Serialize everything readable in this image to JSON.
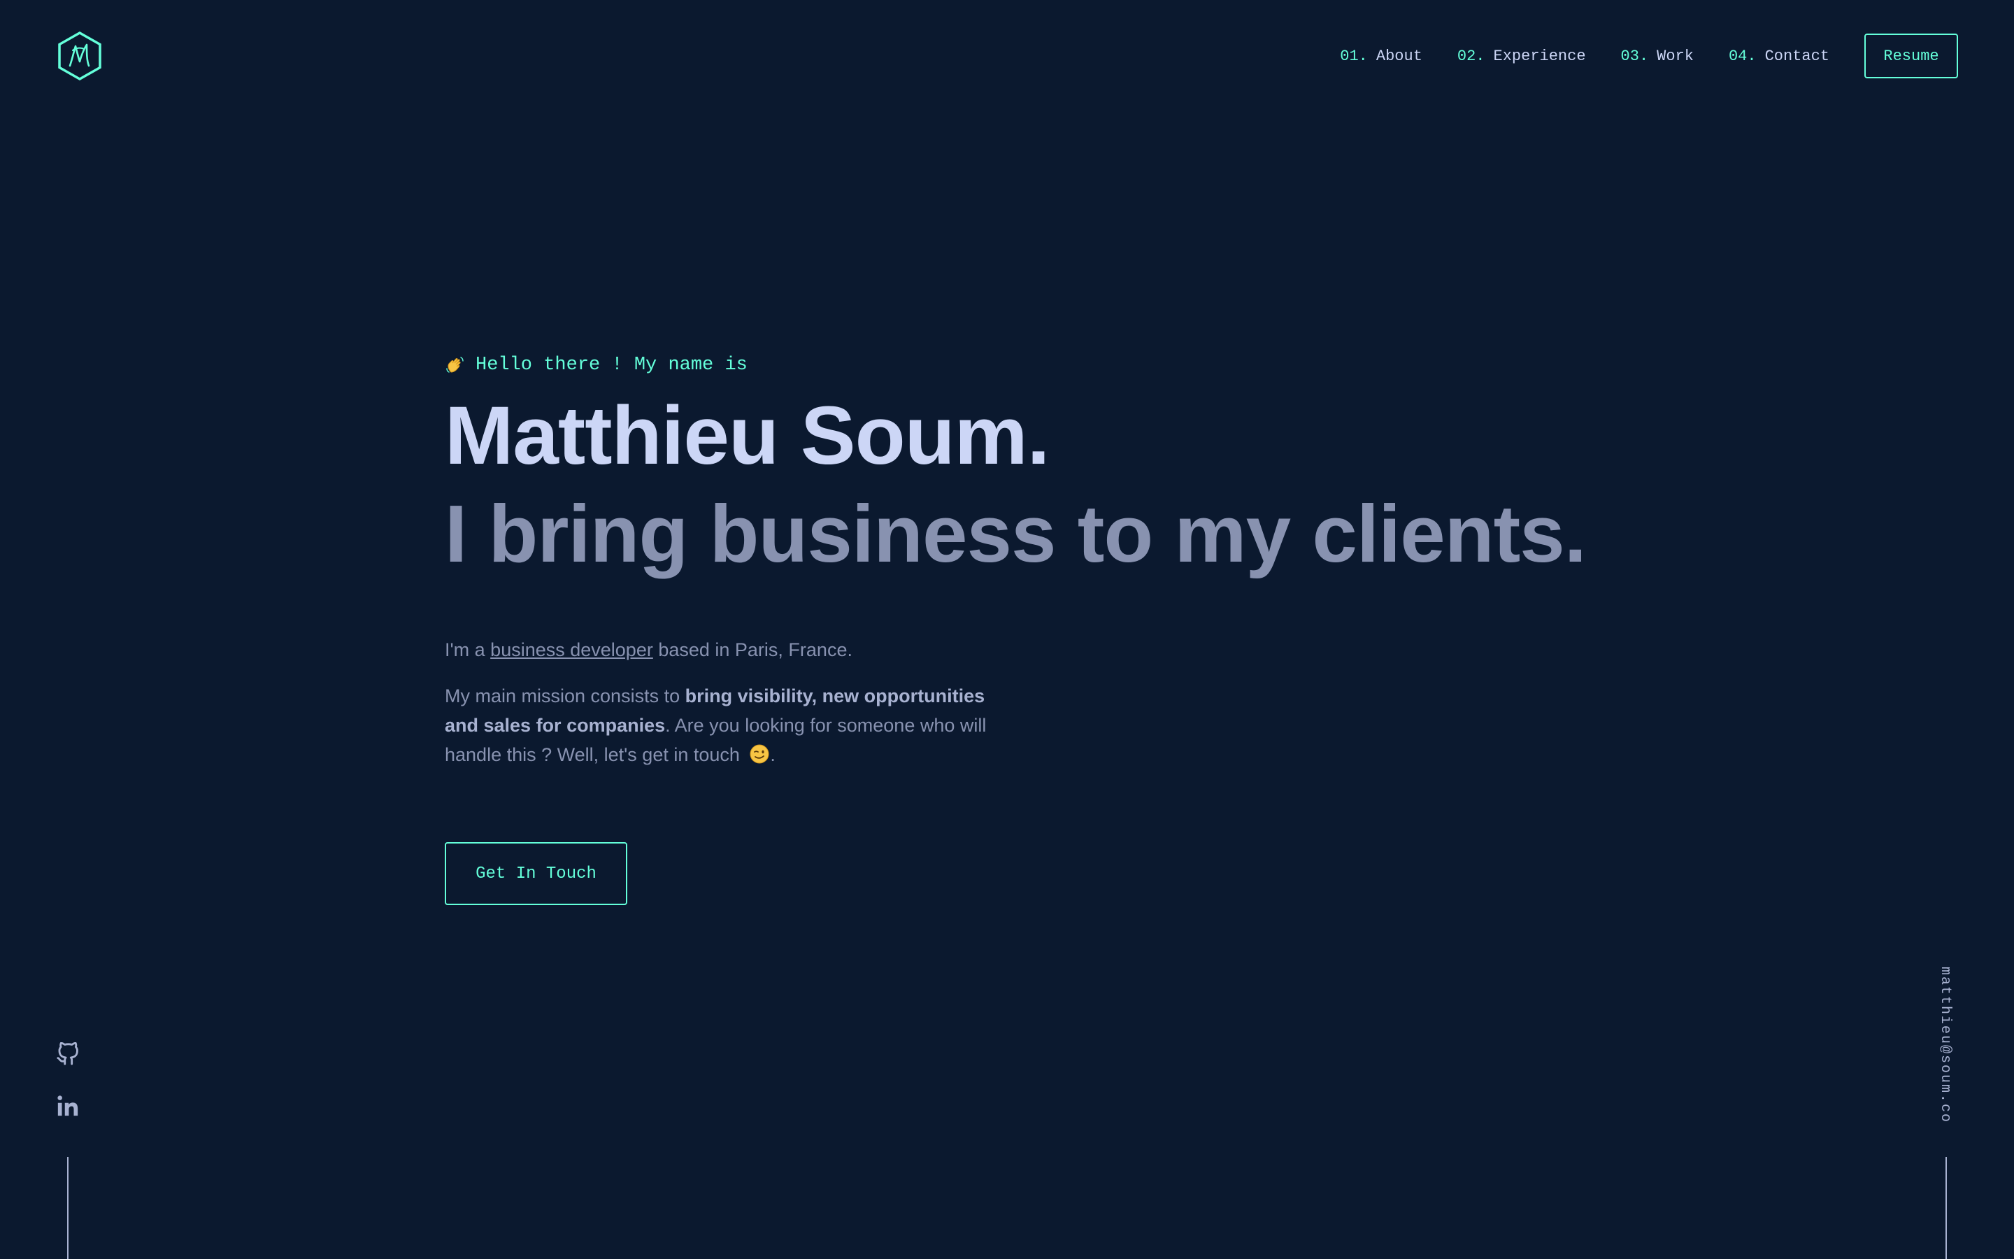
{
  "brand": {
    "logo_icon": "monogram-hexagon-icon",
    "accent": "#64ffda",
    "background": "#0b192f"
  },
  "nav": {
    "items": [
      {
        "num": "01.",
        "label": "About"
      },
      {
        "num": "02.",
        "label": "Experience"
      },
      {
        "num": "03.",
        "label": "Work"
      },
      {
        "num": "04.",
        "label": "Contact"
      }
    ],
    "resume_label": "Resume"
  },
  "hero": {
    "greeting": "Hello there ! My name is",
    "greeting_icon": "waving-hand-icon",
    "name": "Matthieu Soum.",
    "tagline": "I bring business to my clients.",
    "intro_prefix": "I'm a ",
    "intro_link": "business developer",
    "intro_suffix": " based in Paris, France.",
    "mission_prefix": "My main mission consists to ",
    "mission_bold": "bring visibility, new opportunities and sales for companies",
    "mission_suffix": ". Are you looking for someone who will handle this ? Well, let's get in touch ",
    "mission_end_icon": "winking-face-icon",
    "mission_end": ".",
    "cta_label": "Get In Touch"
  },
  "social": [
    {
      "name": "github-icon"
    },
    {
      "name": "linkedin-icon"
    }
  ],
  "email": "matthieu@soum.co"
}
